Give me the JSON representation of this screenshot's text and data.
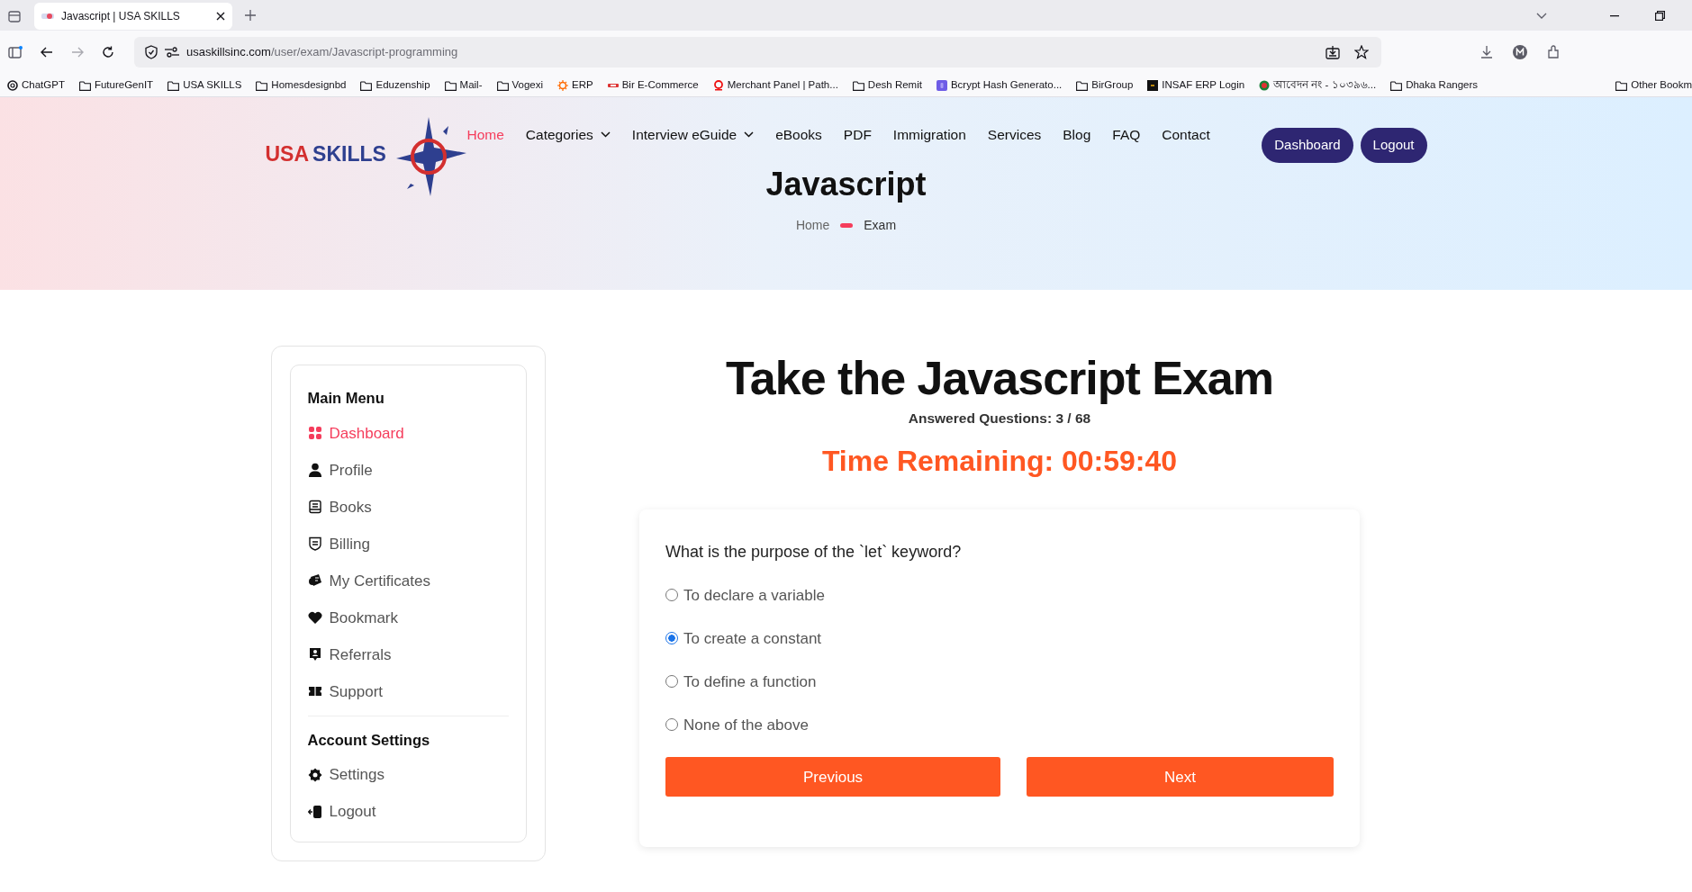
{
  "browser": {
    "tab": {
      "title": "Javascript | USA SKILLS"
    },
    "address": {
      "host": "usaskillsinc.com",
      "path": "/user/exam/Javascript-programming"
    },
    "bookmarks": [
      {
        "label": "ChatGPT",
        "kind": "site"
      },
      {
        "label": "FutureGenIT",
        "kind": "folder"
      },
      {
        "label": "USA SKILLS",
        "kind": "folder"
      },
      {
        "label": "Homesdesignbd",
        "kind": "folder"
      },
      {
        "label": "Eduzenship",
        "kind": "folder"
      },
      {
        "label": "Mail-",
        "kind": "folder"
      },
      {
        "label": "Vogexi",
        "kind": "folder"
      },
      {
        "label": "ERP",
        "kind": "site"
      },
      {
        "label": "Bir E-Commerce",
        "kind": "site"
      },
      {
        "label": "Merchant Panel | Path...",
        "kind": "site"
      },
      {
        "label": "Desh Remit",
        "kind": "folder"
      },
      {
        "label": "Bcrypt Hash Generato...",
        "kind": "site"
      },
      {
        "label": "BirGroup",
        "kind": "folder"
      },
      {
        "label": "INSAF ERP Login",
        "kind": "site"
      },
      {
        "label": "আবেদন নং - ১০৩৯৬...",
        "kind": "site"
      },
      {
        "label": "Dhaka Rangers",
        "kind": "folder"
      }
    ],
    "other_bookmarks": "Other Bookm"
  },
  "header": {
    "logo": {
      "first": "USA",
      "second": "SKILLS"
    },
    "nav": [
      {
        "label": "Home",
        "selected": true,
        "dropdown": false
      },
      {
        "label": "Categories",
        "selected": false,
        "dropdown": true
      },
      {
        "label": "Interview eGuide",
        "selected": false,
        "dropdown": true
      },
      {
        "label": "eBooks",
        "selected": false,
        "dropdown": false
      },
      {
        "label": "PDF",
        "selected": false,
        "dropdown": false
      },
      {
        "label": "Immigration",
        "selected": false,
        "dropdown": false
      },
      {
        "label": "Services",
        "selected": false,
        "dropdown": false
      },
      {
        "label": "Blog",
        "selected": false,
        "dropdown": false
      },
      {
        "label": "FAQ",
        "selected": false,
        "dropdown": false
      },
      {
        "label": "Contact",
        "selected": false,
        "dropdown": false
      }
    ],
    "buttons": [
      "Dashboard",
      "Logout"
    ],
    "title": "Javascript",
    "breadcrumb": [
      "Home",
      "Exam"
    ]
  },
  "sidebar": {
    "sections": [
      {
        "heading": "Main Menu",
        "items": [
          {
            "label": "Dashboard",
            "selected": true
          },
          {
            "label": "Profile",
            "selected": false
          },
          {
            "label": "Books",
            "selected": false
          },
          {
            "label": "Billing",
            "selected": false
          },
          {
            "label": "My Certificates",
            "selected": false
          },
          {
            "label": "Bookmark",
            "selected": false
          },
          {
            "label": "Referrals",
            "selected": false
          },
          {
            "label": "Support",
            "selected": false
          }
        ]
      },
      {
        "heading": "Account Settings",
        "items": [
          {
            "label": "Settings",
            "selected": false
          },
          {
            "label": "Logout",
            "selected": false
          }
        ]
      }
    ]
  },
  "exam": {
    "title": "Take the Javascript Exam",
    "answered": "Answered Questions: 3 / 68",
    "timer": "Time Remaining: 00:59:40",
    "question": "What is the purpose of the `let` keyword?",
    "options": [
      {
        "label": "To declare a variable",
        "selected": false
      },
      {
        "label": "To create a constant",
        "selected": true
      },
      {
        "label": "To define a function",
        "selected": false
      },
      {
        "label": "None of the above",
        "selected": false
      }
    ],
    "buttons": [
      "Previous",
      "Next"
    ]
  }
}
